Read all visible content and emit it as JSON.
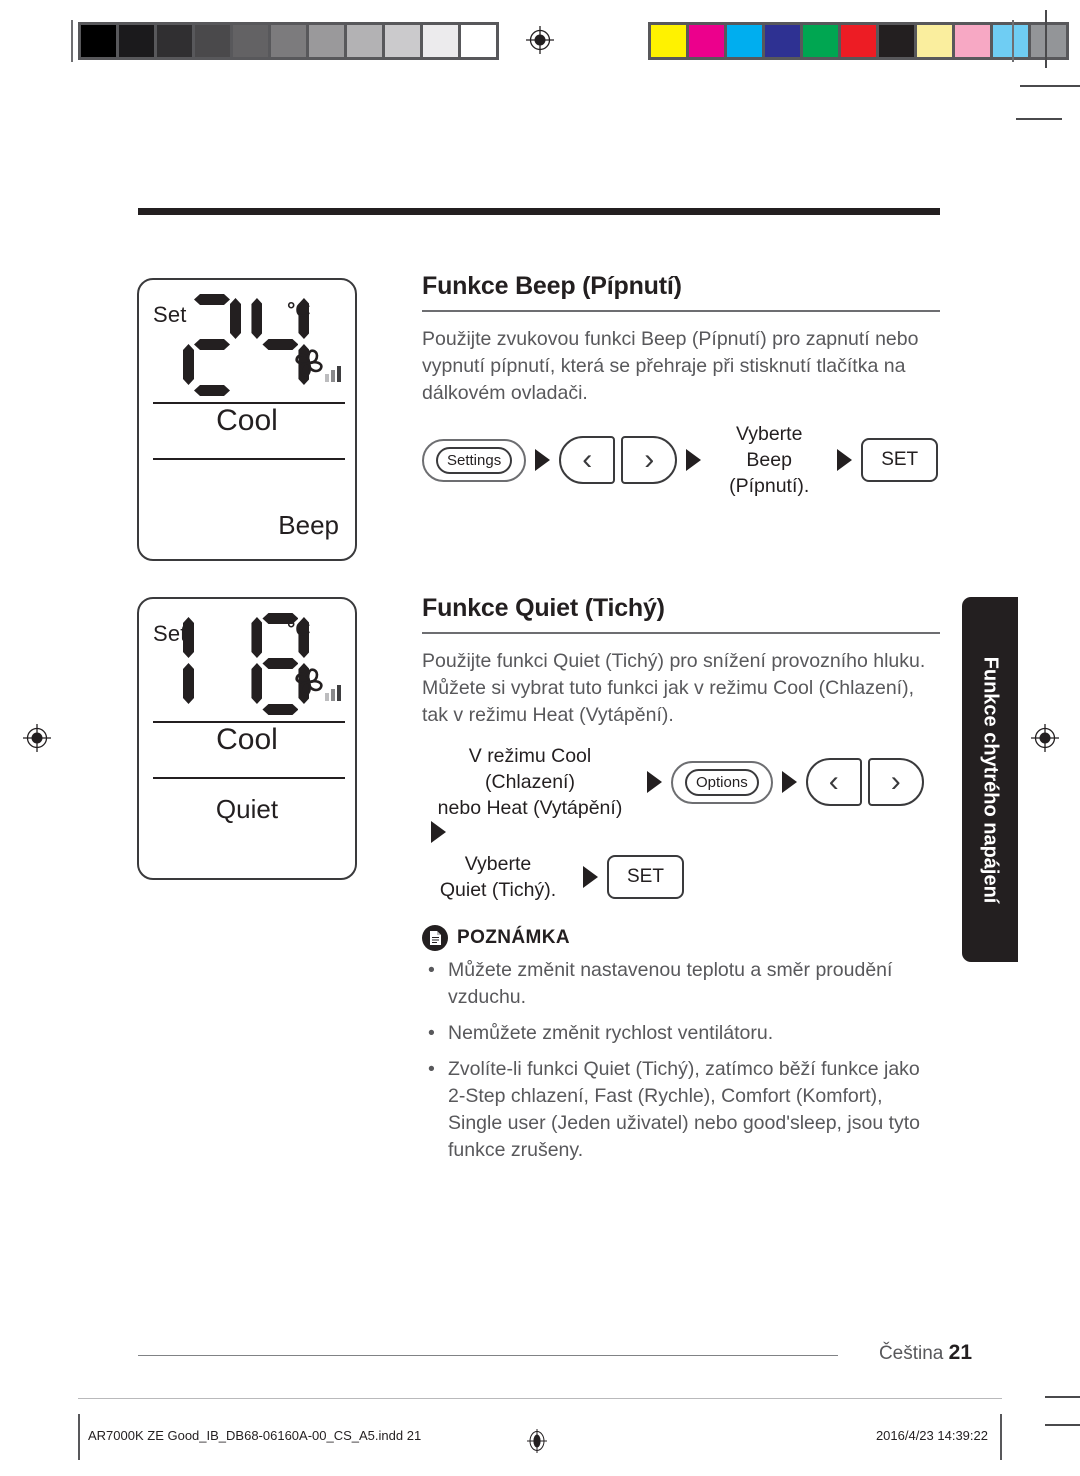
{
  "page": {
    "language_label": "Čeština",
    "page_number": "21"
  },
  "calibration": {
    "grayscale_swatches": [
      "#000000",
      "#1b1a1c",
      "#302f31",
      "#4a494b",
      "#636264",
      "#7c7b7d",
      "#9a999b",
      "#b3b2b4",
      "#cbcacc",
      "#ecebed",
      "#ffffff"
    ],
    "color_swatches": [
      "#fff200",
      "#ec008c",
      "#00aeef",
      "#2e3192",
      "#00a651",
      "#ed1c24",
      "#231f20",
      "#faee9e",
      "#f7a8c4",
      "#6fcdf3",
      "#939598"
    ]
  },
  "side_tab": {
    "label": "Funkce chytrého napájení"
  },
  "lcd_panels": [
    {
      "name": "beep-display",
      "set_label": "Set",
      "temperature": "24",
      "unit": "°C",
      "mode": "Cool",
      "feature": "Beep",
      "fan_icon": "fan-icon",
      "fan_bars": 3
    },
    {
      "name": "quiet-display",
      "set_label": "Set",
      "temperature": "18",
      "unit": "°C",
      "mode": "Cool",
      "feature": "Quiet",
      "fan_icon": "fan-icon",
      "fan_bars": 3
    }
  ],
  "sections": [
    {
      "id": "beep",
      "title": "Funkce Beep (Pípnutí)",
      "body": "Použijte zvukovou funkci Beep (Pípnutí) pro zapnutí nebo vypnutí pípnutí, která se přehraje při stisknutí tlačítka na dálkovém ovladači.",
      "flow": {
        "settings_button": "Settings",
        "left_arrow": "‹",
        "right_arrow": "›",
        "select_text": "Vyberte\nBeep\n(Pípnutí).",
        "select_line1": "Vyberte",
        "select_line2": "Beep",
        "select_line3": "(Pípnutí).",
        "set_button": "SET"
      }
    },
    {
      "id": "quiet",
      "title": "Funkce Quiet (Tichý)",
      "body": "Použijte funkci Quiet (Tichý) pro snížení provozního hluku. Můžete si vybrat tuto funkci jak v režimu Cool (Chlazení), tak v režimu Heat (Vytápění).",
      "flow": {
        "mode_line1": "V režimu Cool (Chlazení)",
        "mode_line2": "nebo Heat (Vytápění)",
        "options_button": "Options",
        "left_arrow": "‹",
        "right_arrow": "›",
        "select_line1": "Vyberte",
        "select_line2": "Quiet (Tichý).",
        "set_button": "SET"
      },
      "note": {
        "icon": "note-document-icon",
        "title": "POZNÁMKA",
        "items": [
          "Můžete změnit nastavenou teplotu a směr proudění vzduchu.",
          "Nemůžete změnit rychlost ventilátoru.",
          "Zvolíte-li funkci Quiet (Tichý), zatímco běží funkce jako 2-Step chlazení, Fast (Rychle), Comfort (Komfort), Single user (Jeden uživatel) nebo good'sleep, jsou tyto funkce zrušeny."
        ]
      }
    }
  ],
  "print_footer": {
    "file_name": "AR7000K ZE Good_IB_DB68-06160A-00_CS_A5.indd   21",
    "timestamp": "2016/4/23   14:39:22"
  }
}
